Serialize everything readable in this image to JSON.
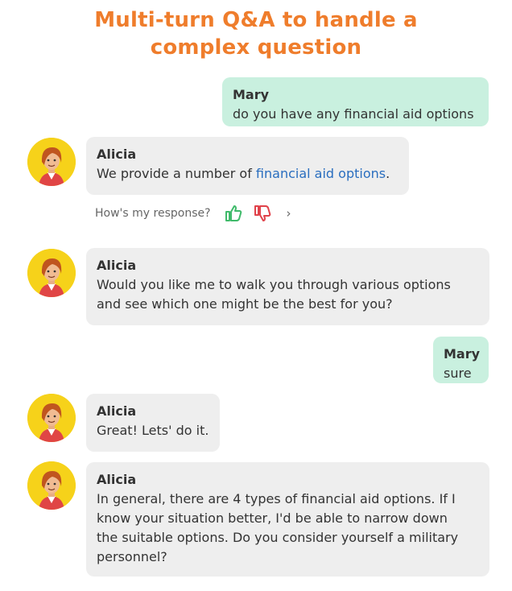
{
  "title_line1": "Multi-turn Q&A to handle a",
  "title_line2": "complex question",
  "messages": [
    {
      "sender": "Mary",
      "text": "do you have any financial aid options"
    },
    {
      "sender": "Alicia",
      "text_before": "We provide a number of ",
      "link": "financial aid options",
      "text_after": "."
    },
    {
      "sender": "Alicia",
      "line1": "Would you like me to walk you through various options",
      "line2": "and see which one might be the best for you?"
    },
    {
      "sender": "Mary",
      "text": "sure"
    },
    {
      "sender": "Alicia",
      "text": "Great! Lets' do it."
    },
    {
      "sender": "Alicia",
      "line1": "In general, there are 4 types of financial aid options. If I",
      "line2": "know your situation better, I'd be able to narrow down",
      "line3": "the suitable options. Do you consider yourself a military",
      "line4": "personnel?"
    }
  ],
  "feedback": {
    "prompt": "How's my response?",
    "chevron": "›"
  },
  "colors": {
    "title": "#ef7d2c",
    "user_bubble": "#c9f0df",
    "bot_bubble": "#eeeeee",
    "link": "#2a6ebf",
    "thumbs_up": "#3fba6a",
    "thumbs_down": "#e0424a"
  },
  "icons": [
    "thumbs-up-icon",
    "thumbs-down-icon",
    "chevron-right-icon"
  ]
}
